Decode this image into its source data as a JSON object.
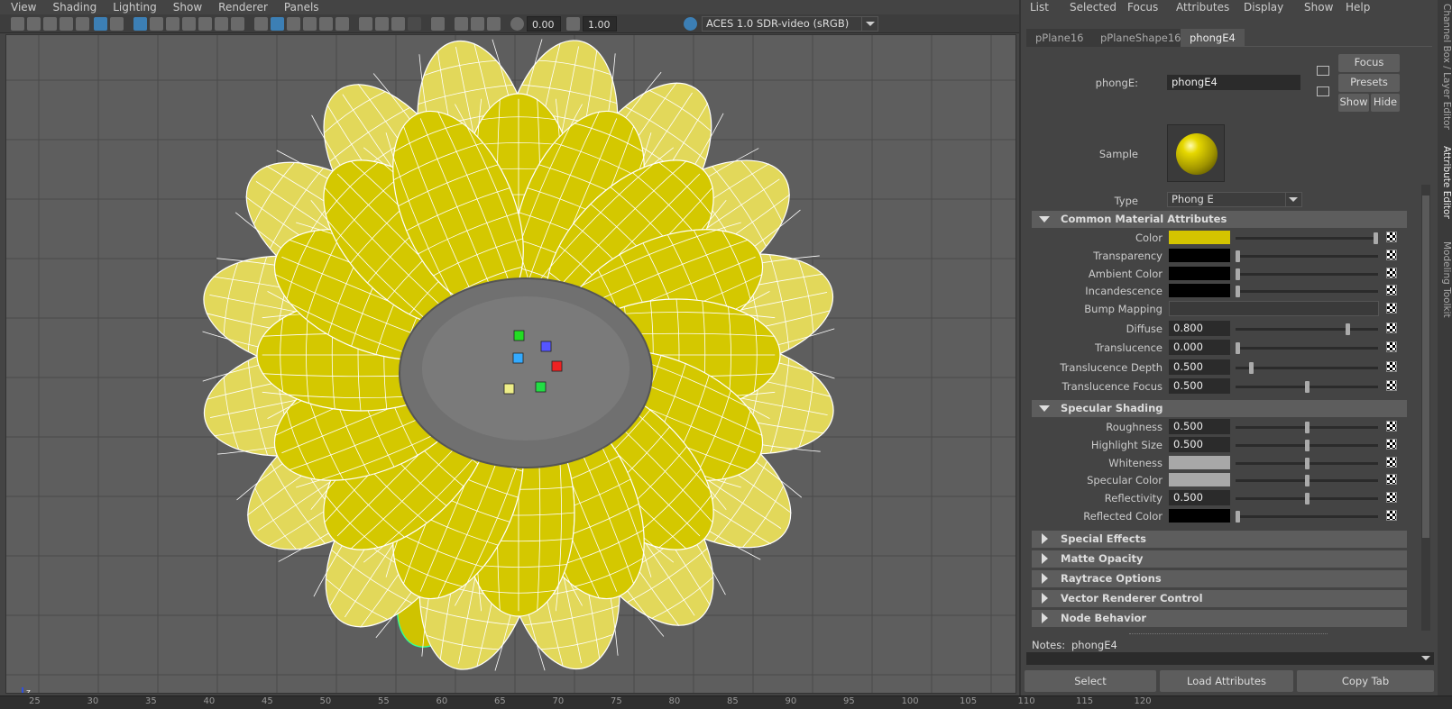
{
  "viewport": {
    "menu": [
      "View",
      "Shading",
      "Lighting",
      "Show",
      "Renderer",
      "Panels"
    ],
    "exposure": "0.00",
    "gamma": "1.00",
    "color_space": "ACES 1.0 SDR-video (sRGB)"
  },
  "timeline": {
    "ticks": [
      "25",
      "30",
      "35",
      "40",
      "45",
      "50",
      "55",
      "60",
      "65",
      "70",
      "75",
      "80",
      "85",
      "90",
      "95",
      "100",
      "105",
      "110",
      "115",
      "120"
    ]
  },
  "attribute_editor": {
    "menu": [
      "List",
      "Selected",
      "Focus",
      "Attributes",
      "Display",
      "Show",
      "Help"
    ],
    "tabs": [
      "pPlane16",
      "pPlaneShape16",
      "phongE4"
    ],
    "active_tab": "phongE4",
    "node_label": "phongE:",
    "node_name": "phongE4",
    "buttons": {
      "focus": "Focus",
      "presets": "Presets",
      "show": "Show",
      "hide": "Hide"
    },
    "sample_label": "Sample",
    "type_label": "Type",
    "type_value": "Phong E",
    "sections": {
      "common": "Common Material Attributes",
      "specular": "Specular Shading",
      "special": "Special Effects",
      "matte": "Matte Opacity",
      "raytrace": "Raytrace Options",
      "vector": "Vector Renderer Control",
      "node": "Node Behavior"
    },
    "common_attrs": [
      {
        "label": "Color",
        "swatch": "#d4c400",
        "slider": 1.0
      },
      {
        "label": "Transparency",
        "swatch": "#000000",
        "slider": 0.0
      },
      {
        "label": "Ambient Color",
        "swatch": "#000000",
        "slider": 0.0
      },
      {
        "label": "Incandescence",
        "swatch": "#000000",
        "slider": 0.0
      },
      {
        "label": "Bump Mapping"
      },
      {
        "label": "Diffuse",
        "value": "0.800",
        "slider": 0.8
      },
      {
        "label": "Translucence",
        "value": "0.000",
        "slider": 0.0
      },
      {
        "label": "Translucence Depth",
        "value": "0.500",
        "slider": 0.1
      },
      {
        "label": "Translucence Focus",
        "value": "0.500",
        "slider": 0.5
      }
    ],
    "specular_attrs": [
      {
        "label": "Roughness",
        "value": "0.500",
        "slider": 0.5
      },
      {
        "label": "Highlight Size",
        "value": "0.500",
        "slider": 0.5
      },
      {
        "label": "Whiteness",
        "swatch": "#a8a8a8",
        "slider": 0.5
      },
      {
        "label": "Specular Color",
        "swatch": "#a8a8a8",
        "slider": 0.5
      },
      {
        "label": "Reflectivity",
        "value": "0.500",
        "slider": 0.5
      },
      {
        "label": "Reflected Color",
        "swatch": "#000000",
        "slider": 0.0
      }
    ],
    "notes_label": "Notes:",
    "notes_value": "phongE4",
    "bottom_buttons": [
      "Select",
      "Load Attributes",
      "Copy Tab"
    ]
  },
  "side_tabs": [
    "Channel Box / Layer Editor",
    "Attribute Editor",
    "Modeling Toolkit"
  ],
  "colors": {
    "petal": "#d4c800",
    "petal_light": "#e2d85a",
    "center": "#707070",
    "accent": "#2d8fd6"
  }
}
